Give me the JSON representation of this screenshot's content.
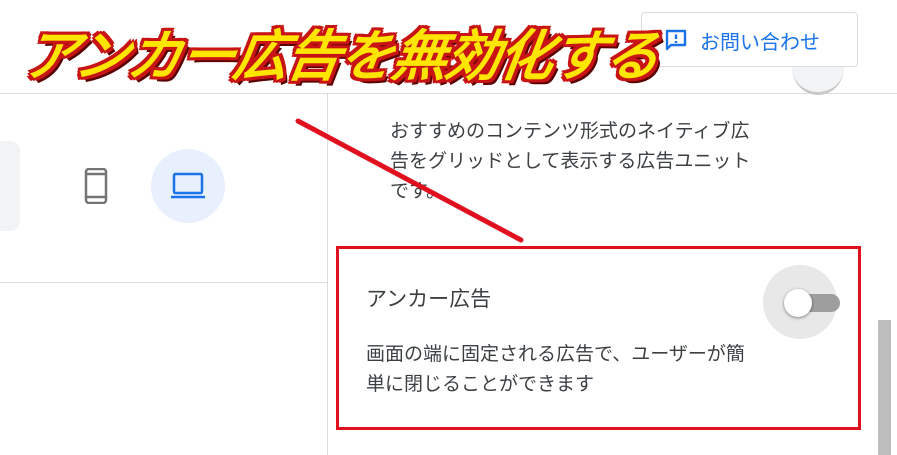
{
  "annotation": {
    "banner_text": "アンカー広告を無効化する"
  },
  "header": {
    "contact_button_label": "お問い合わせ",
    "contact_icon": "feedback-icon"
  },
  "preview": {
    "devices": [
      {
        "name": "phone",
        "icon": "smartphone-icon",
        "selected": false
      },
      {
        "name": "desktop",
        "icon": "laptop-icon",
        "selected": true
      }
    ]
  },
  "settings": {
    "native_ads_description": "おすすめのコンテンツ形式のネイティブ広告をグリッドとして表示する広告ユニットです。",
    "anchor_ads": {
      "title": "アンカー広告",
      "description": "画面の端に固定される広告で、ユーザーが簡単に閉じることができます",
      "enabled": false
    }
  },
  "colors": {
    "accent": "#1a73e8",
    "highlight_border": "#e0101e",
    "banner_fill": "#ffe500",
    "banner_outline": "#c81414"
  }
}
